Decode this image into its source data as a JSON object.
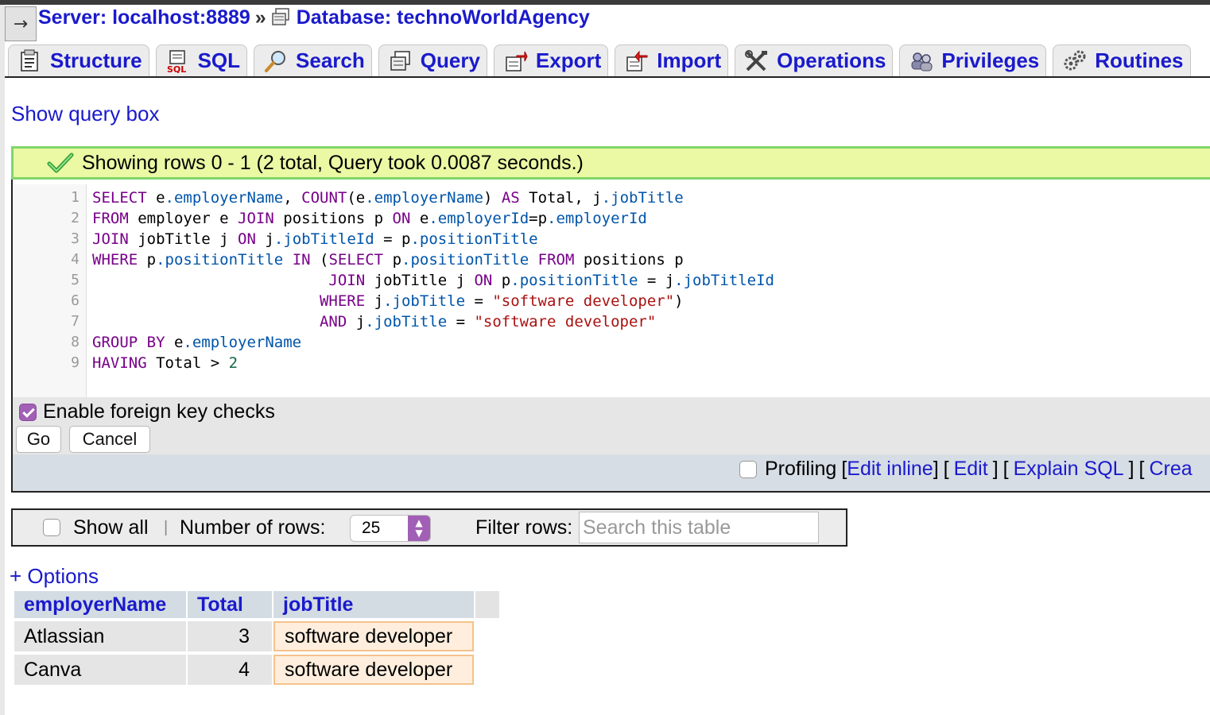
{
  "breadcrumb": {
    "server": "Server: localhost:8889",
    "separator": "»",
    "database": "Database: technoWorldAgency"
  },
  "collapse_glyph": "→",
  "tabs": [
    {
      "label": "Structure",
      "icon": "structure-icon"
    },
    {
      "label": "SQL",
      "icon": "sql-icon"
    },
    {
      "label": "Search",
      "icon": "search-icon"
    },
    {
      "label": "Query",
      "icon": "query-icon"
    },
    {
      "label": "Export",
      "icon": "export-icon"
    },
    {
      "label": "Import",
      "icon": "import-icon"
    },
    {
      "label": "Operations",
      "icon": "operations-icon"
    },
    {
      "label": "Privileges",
      "icon": "privileges-icon"
    },
    {
      "label": "Routines",
      "icon": "routines-icon"
    }
  ],
  "show_query_box": "Show query box",
  "success_message": "Showing rows 0 - 1 (2 total, Query took 0.0087 seconds.)",
  "sql_lines": [
    [
      [
        "kw",
        "SELECT"
      ],
      [
        "txt",
        " e"
      ],
      [
        "fld",
        ".employerName"
      ],
      [
        "txt",
        ", "
      ],
      [
        "kw",
        "COUNT"
      ],
      [
        "txt",
        "(e"
      ],
      [
        "fld",
        ".employerName"
      ],
      [
        "txt",
        ") "
      ],
      [
        "kw",
        "AS"
      ],
      [
        "txt",
        " Total, j"
      ],
      [
        "fld",
        ".jobTitle"
      ]
    ],
    [
      [
        "kw",
        "FROM"
      ],
      [
        "txt",
        " employer e "
      ],
      [
        "kw",
        "JOIN"
      ],
      [
        "txt",
        " positions p "
      ],
      [
        "kw",
        "ON"
      ],
      [
        "txt",
        " e"
      ],
      [
        "fld",
        ".employerId"
      ],
      [
        "txt",
        "=p"
      ],
      [
        "fld",
        ".employerId"
      ]
    ],
    [
      [
        "kw",
        "JOIN"
      ],
      [
        "txt",
        " jobTitle j "
      ],
      [
        "kw",
        "ON"
      ],
      [
        "txt",
        " j"
      ],
      [
        "fld",
        ".jobTitleId"
      ],
      [
        "txt",
        " = p"
      ],
      [
        "fld",
        ".positionTitle"
      ]
    ],
    [
      [
        "kw",
        "WHERE"
      ],
      [
        "txt",
        " p"
      ],
      [
        "fld",
        ".positionTitle"
      ],
      [
        "txt",
        " "
      ],
      [
        "kw",
        "IN"
      ],
      [
        "txt",
        " ("
      ],
      [
        "kw",
        "SELECT"
      ],
      [
        "txt",
        " p"
      ],
      [
        "fld",
        ".positionTitle"
      ],
      [
        "txt",
        " "
      ],
      [
        "kw",
        "FROM"
      ],
      [
        "txt",
        " positions p"
      ]
    ],
    [
      [
        "txt",
        "                          "
      ],
      [
        "kw",
        "JOIN"
      ],
      [
        "txt",
        " jobTitle j "
      ],
      [
        "kw",
        "ON"
      ],
      [
        "txt",
        " p"
      ],
      [
        "fld",
        ".positionTitle"
      ],
      [
        "txt",
        " = j"
      ],
      [
        "fld",
        ".jobTitleId"
      ]
    ],
    [
      [
        "txt",
        "                         "
      ],
      [
        "kw",
        "WHERE"
      ],
      [
        "txt",
        " j"
      ],
      [
        "fld",
        ".jobTitle"
      ],
      [
        "txt",
        " = "
      ],
      [
        "str",
        "\"software developer\""
      ],
      [
        "txt",
        ")"
      ]
    ],
    [
      [
        "txt",
        "                         "
      ],
      [
        "kw",
        "AND"
      ],
      [
        "txt",
        " j"
      ],
      [
        "fld",
        ".jobTitle"
      ],
      [
        "txt",
        " = "
      ],
      [
        "str",
        "\"software developer\""
      ]
    ],
    [
      [
        "kw",
        "GROUP BY"
      ],
      [
        "txt",
        " e"
      ],
      [
        "fld",
        ".employerName"
      ]
    ],
    [
      [
        "kw",
        "HAVING"
      ],
      [
        "txt",
        " Total > "
      ],
      [
        "num",
        "2"
      ]
    ]
  ],
  "foreign_key_label": "Enable foreign key checks",
  "foreign_key_checked": true,
  "go_label": "Go",
  "cancel_label": "Cancel",
  "profiling": {
    "label": "Profiling",
    "open": "[",
    "close": "]",
    "edit_inline": "Edit inline",
    "edit": "Edit",
    "explain": "Explain SQL",
    "create": "Crea"
  },
  "nav": {
    "show_all": "Show all",
    "divider": "|",
    "rows_label": "Number of rows:",
    "rows_value": "25",
    "filter_label": "Filter rows:",
    "filter_placeholder": "Search this table"
  },
  "options_link": "+ Options",
  "table": {
    "columns": [
      "employerName",
      "Total",
      "jobTitle"
    ],
    "rows": [
      [
        "Atlassian",
        "3",
        "software developer"
      ],
      [
        "Canva",
        "4",
        "software developer"
      ]
    ]
  },
  "colors": {
    "link": "#1a1acc",
    "success_bg": "#ebf8a4",
    "success_border": "#7fd66b",
    "checkbox_accent": "#a15fb5",
    "header_bg": "#d3dce3",
    "highlight_bg": "#ffeedd",
    "highlight_border": "#f5c28c"
  }
}
